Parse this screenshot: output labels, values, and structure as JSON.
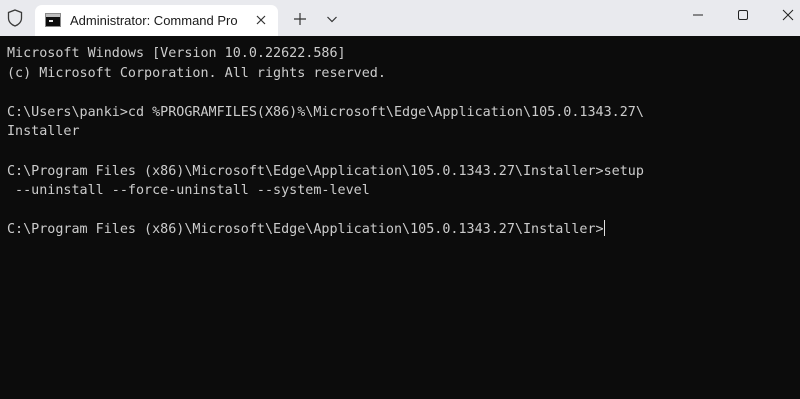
{
  "window": {
    "tab_title": "Administrator: Command Pro"
  },
  "icons": {
    "shield": "shield-icon",
    "tab": "command-prompt-icon",
    "tab_close": "close-icon",
    "new_tab": "plus-icon",
    "dropdown": "chevron-down-icon",
    "minimize": "minimize-icon",
    "maximize": "maximize-icon",
    "close": "close-icon"
  },
  "terminal": {
    "lines": [
      "Microsoft Windows [Version 10.0.22622.586]",
      "(c) Microsoft Corporation. All rights reserved.",
      "",
      "C:\\Users\\panki>cd %PROGRAMFILES(X86)%\\Microsoft\\Edge\\Application\\105.0.1343.27\\",
      "Installer",
      "",
      "C:\\Program Files (x86)\\Microsoft\\Edge\\Application\\105.0.1343.27\\Installer>setup",
      " --uninstall --force-uninstall --system-level",
      "",
      "C:\\Program Files (x86)\\Microsoft\\Edge\\Application\\105.0.1343.27\\Installer>"
    ]
  },
  "colors": {
    "terminal_bg": "#0c0c0c",
    "terminal_fg": "#cccccc",
    "titlebar_bg": "#e9eaee",
    "tab_bg": "#ffffff"
  }
}
